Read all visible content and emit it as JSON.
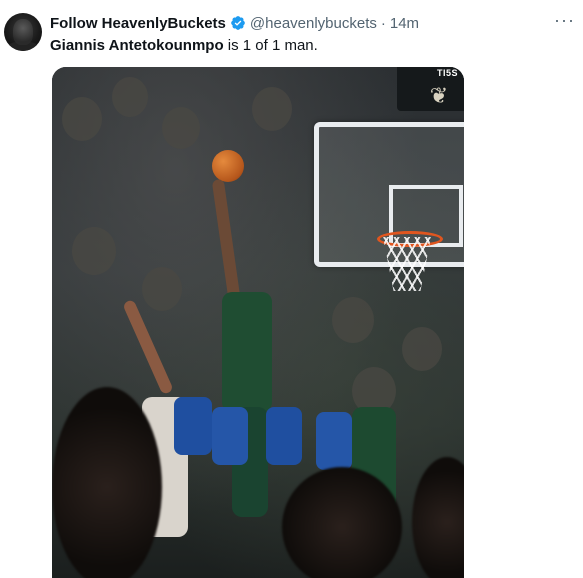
{
  "post": {
    "display_name": "Follow HeavenlyBuckets",
    "handle": "@heavenlybuckets",
    "separator": "·",
    "time": "14m",
    "more_label": "···",
    "text_bold": "Giannis Antetokounmpo",
    "text_rest": " is 1 of 1 man."
  },
  "media": {
    "scoreboard_label": "TI5S"
  },
  "icons": {
    "verified": "verified-badge-icon",
    "more": "more-options-icon",
    "team_logo": "bucks-logo-icon"
  },
  "colors": {
    "verified_blue": "#1d9bf0",
    "secondary_text": "#536471",
    "primary_text": "#0f1419"
  }
}
